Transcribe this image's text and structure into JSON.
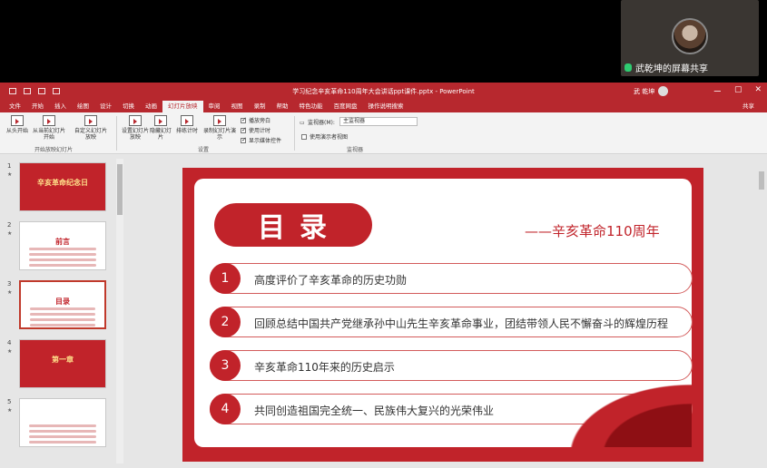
{
  "webcam": {
    "name": "武乾坤的屏幕共享"
  },
  "window": {
    "title": "学习纪念辛亥革命110周年大会讲话ppt课件.pptx - PowerPoint",
    "user": "武 乾坤",
    "controls": [
      "ー",
      "▢",
      "✕"
    ]
  },
  "tabs": [
    "文件",
    "开始",
    "插入",
    "绘图",
    "设计",
    "切换",
    "动画",
    "幻灯片放映",
    "审阅",
    "视图",
    "录制",
    "帮助",
    "特色功能",
    "百度网盘",
    "操作说明搜索"
  ],
  "active_tab_index": 7,
  "share_label": "共享",
  "ribbon": {
    "from_start": "从头开始",
    "from_current": "从当前幻灯片开始",
    "custom": "自定义幻灯片放映",
    "group1": "开始放映幻灯片",
    "setup": "设置幻灯片放映",
    "hide": "隐藏幻灯片",
    "rehearse": "排练计时",
    "record": "录制幻灯片演示",
    "group2": "设置",
    "chk_narration": "播放旁白",
    "chk_timing": "使用计时",
    "chk_controls": "显示媒体控件",
    "monitor_label": "监视器(M):",
    "monitor_value": "主监视器",
    "presenter_view": "使用演示者视图",
    "group3": "监视器"
  },
  "thumbnails": [
    {
      "num": "1",
      "star": "★",
      "text": "辛亥革命纪念日"
    },
    {
      "num": "2",
      "star": "★",
      "text": "前言"
    },
    {
      "num": "3",
      "star": "★",
      "text": "目录"
    },
    {
      "num": "4",
      "star": "★",
      "text": "第一章"
    },
    {
      "num": "5",
      "star": "★",
      "text": ""
    }
  ],
  "slide": {
    "title": "目录",
    "subtitle": "——辛亥革命110周年",
    "items": [
      {
        "num": "1",
        "text": "高度评价了辛亥革命的历史功勋"
      },
      {
        "num": "2",
        "text": "回顾总结中国共产党继承孙中山先生辛亥革命事业，团结带领人民不懈奋斗的辉煌历程"
      },
      {
        "num": "3",
        "text": "辛亥革命110年来的历史启示"
      },
      {
        "num": "4",
        "text": "共同创造祖国完全统一、民族伟大复兴的光荣伟业"
      }
    ]
  },
  "colors": {
    "accent": "#c1232a",
    "titlebar": "#b7282e"
  }
}
